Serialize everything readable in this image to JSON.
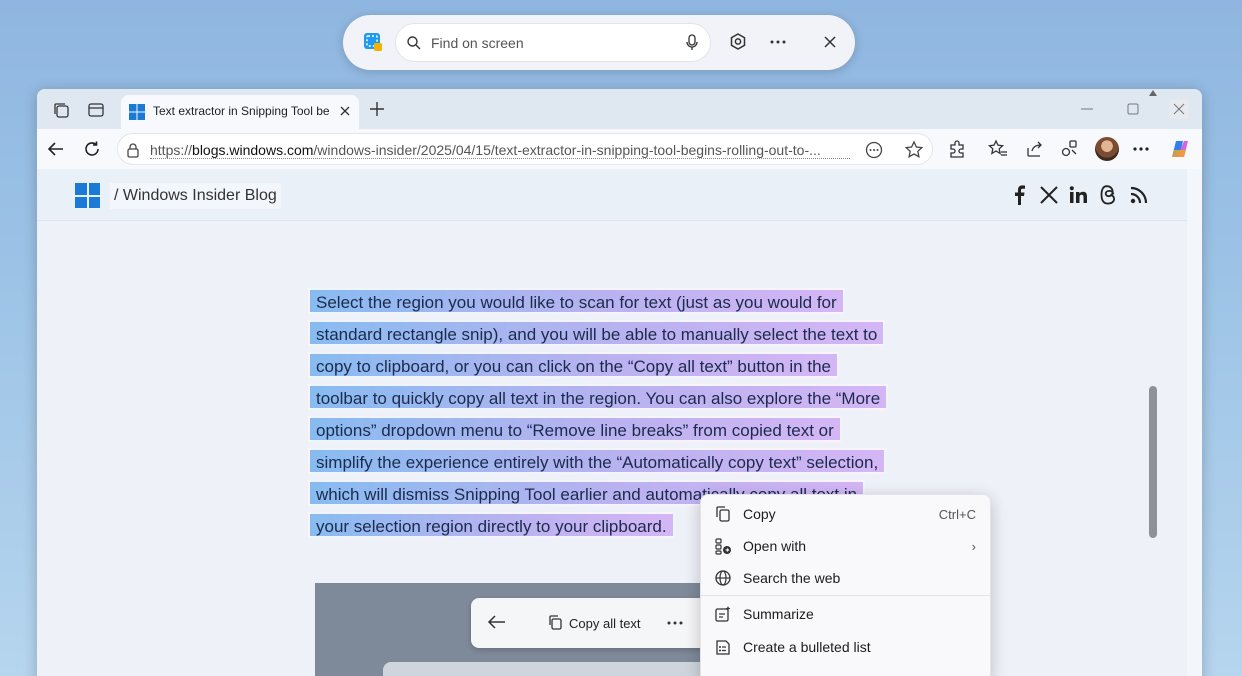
{
  "snipping_bar": {
    "search_placeholder": "Find on screen"
  },
  "browser": {
    "tab": {
      "title": "Text extractor in Snipping Tool be"
    },
    "address": {
      "url_scheme": "https://",
      "url_host": "blogs.windows.com",
      "url_path": "/windows-insider/2025/04/15/text-extractor-in-snipping-tool-begins-rolling-out-to-..."
    }
  },
  "site": {
    "blog_title": "/ Windows Insider Blog",
    "social_icons": [
      "facebook-icon",
      "x-icon",
      "linkedin-icon",
      "threads-icon",
      "rss-icon"
    ]
  },
  "selected_text_lines": [
    "Select the region you would like to scan for text (just as you would for",
    "standard rectangle snip), and you will be able to manually select the text to",
    "copy to clipboard, or you can click on the “Copy all text” button in the",
    "toolbar to quickly copy all text in the region. You can also explore the “More",
    "options” dropdown menu to “Remove line breaks” from copied text or",
    "simplify the experience entirely with the “Automatically copy text” selection,",
    "which will dismiss Snipping Tool earlier and automatically copy all text in",
    "your selection region directly to your clipboard."
  ],
  "snip_toolbar": {
    "copy_all_label": "Copy all text"
  },
  "context_menu": {
    "items": [
      {
        "label": "Copy",
        "shortcut": "Ctrl+C",
        "icon": "copy-icon"
      },
      {
        "label": "Open with",
        "submenu": "›",
        "icon": "open-with-icon"
      },
      {
        "label": "Search the web",
        "icon": "globe-icon"
      },
      {
        "label": "Summarize",
        "icon": "summarize-icon"
      },
      {
        "label": "Create a bulleted list",
        "icon": "bulleted-list-icon"
      }
    ]
  },
  "colors": {
    "selection_start": "#82b9f0",
    "selection_end": "#d2aff5",
    "ms_blue": "#1a7ad6"
  }
}
